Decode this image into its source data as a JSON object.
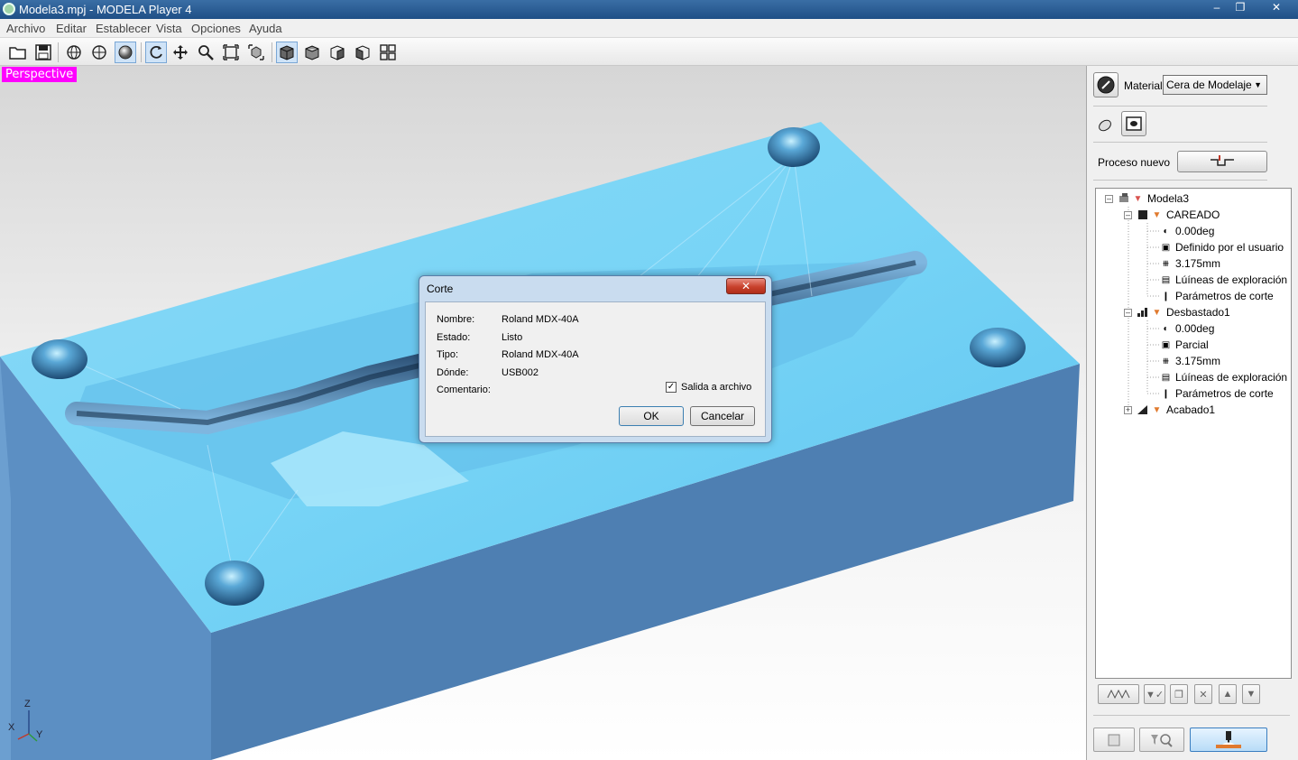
{
  "window": {
    "title": "Modela3.mpj - MODELA Player 4"
  },
  "menu": [
    "Archivo",
    "Editar",
    "Establecer",
    "Vista",
    "Opciones",
    "Ayuda"
  ],
  "viewport": {
    "label": "Perspective",
    "axes": {
      "z": "Z",
      "x": "X",
      "y": "Y"
    }
  },
  "dialog": {
    "title": "Corte",
    "fields": [
      {
        "label": "Nombre:",
        "value": "Roland MDX-40A"
      },
      {
        "label": "Estado:",
        "value": "Listo"
      },
      {
        "label": "Tipo:",
        "value": "Roland MDX-40A"
      },
      {
        "label": "Dónde:",
        "value": "USB002"
      },
      {
        "label": "Comentario:",
        "value": ""
      }
    ],
    "checkbox_label": "Salida a archivo",
    "checkbox_checked": true,
    "ok_label": "OK",
    "cancel_label": "Cancelar"
  },
  "panel": {
    "material_label": "Material",
    "material_value": "Cera de Modelaje",
    "new_process_label": "Proceso nuevo",
    "tree": {
      "root": "Modela3",
      "careado": {
        "label": "CAREADO",
        "items": [
          "0.00deg",
          "Definido por el usuario",
          "3.175mm",
          "Lúíneas de exploración",
          "Parámetros de corte"
        ]
      },
      "desbastado": {
        "label": "Desbastado1",
        "items": [
          "0.00deg",
          "Parcial",
          "3.175mm",
          "Lúíneas de exploración",
          "Parámetros de corte"
        ]
      },
      "acabado": {
        "label": "Acabado1"
      }
    }
  }
}
